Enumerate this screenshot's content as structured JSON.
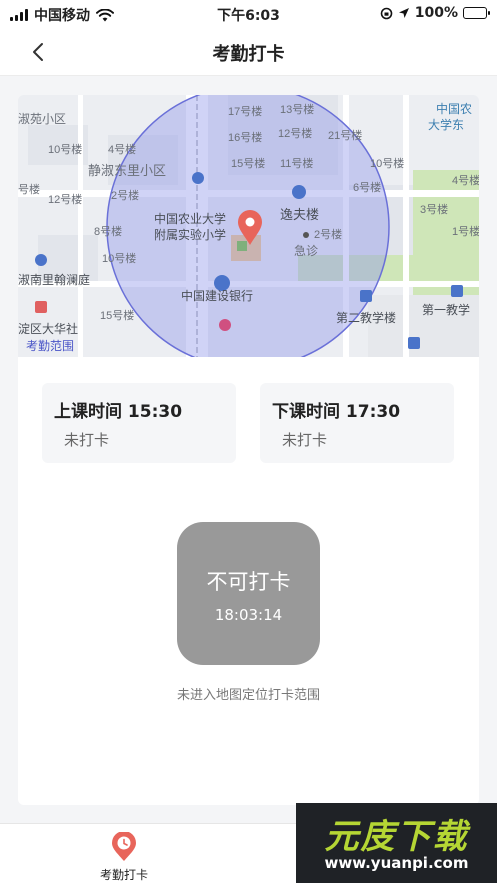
{
  "status_bar": {
    "carrier": "中国移动",
    "time": "下午6:03",
    "battery": "100%"
  },
  "nav": {
    "title": "考勤打卡"
  },
  "map": {
    "labels": {
      "l1": "淑苑小区",
      "l2": "10号楼",
      "l3": "4号楼",
      "l4": "静淑东里小区",
      "l5": "12号楼",
      "l6": "2号楼",
      "l7": "8号楼",
      "l8": "号楼",
      "l9": "10号楼",
      "l10": "淑南里翰澜庭",
      "l11": "15号楼",
      "l12": "淀区大华社",
      "l13": "考勤范围",
      "l14": "17号楼",
      "l15": "13号楼",
      "l16": "16号楼",
      "l17": "12号楼",
      "l18": "21号楼",
      "l19": "15号楼",
      "l20": "11号楼",
      "l21": "10号楼",
      "l22": "6号楼",
      "l23": "逸夫楼",
      "l24": "急诊",
      "l25": "中国农业大学",
      "l26": "附属实验小学",
      "l27": "中国建设银行",
      "l28": "第二教学楼",
      "l29": "第一教学",
      "l30": "中国农",
      "l31": "大学东",
      "l32": "4号楼",
      "l33": "3号楼",
      "l34": "1号楼",
      "l35": "2号楼"
    }
  },
  "schedule": {
    "start_label": "上课时间 15:30",
    "start_status": "未打卡",
    "end_label": "下课时间 17:30",
    "end_status": "未打卡"
  },
  "punch": {
    "label": "不可打卡",
    "time": "18:03:14",
    "hint": "未进入地图定位打卡范围"
  },
  "tabbar": {
    "tab1_label": "考勤打卡"
  },
  "watermark": {
    "title": "元庋下载",
    "url": "www.yuanpi.com"
  },
  "colors": {
    "accent": "#e8655b",
    "range_fill": "#8f96ea",
    "button_disabled": "#999999",
    "watermark_green": "#b5d634"
  }
}
